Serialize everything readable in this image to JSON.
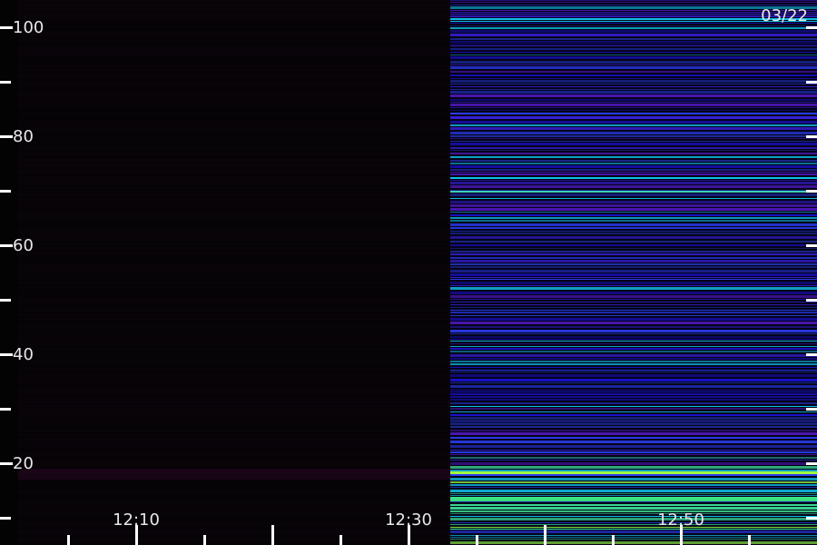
{
  "chart_data": {
    "type": "heatmap",
    "date_label": "03/22",
    "y_axis": {
      "range": [
        7,
        105
      ],
      "major_ticks": [
        100,
        80,
        60,
        40,
        20
      ],
      "minor_ticks": [
        90,
        70,
        50,
        30,
        10
      ]
    },
    "x_axis": {
      "labels": [
        "12:10",
        "12:30",
        "12:50"
      ]
    },
    "segments": [
      {
        "from": "start",
        "to": "12:36",
        "intensity": "very low",
        "color": "#050305"
      },
      {
        "from": "12:36",
        "to": "end",
        "intensity": "high",
        "palette": [
          "#1a10c8",
          "#2a3cf0",
          "#5a1ad0",
          "#10c8f0",
          "#40f0a0",
          "#90f040"
        ]
      }
    ],
    "colors": {
      "background": "#000000",
      "low_band": "#5a1aa0",
      "axis": "#ffffff"
    }
  }
}
